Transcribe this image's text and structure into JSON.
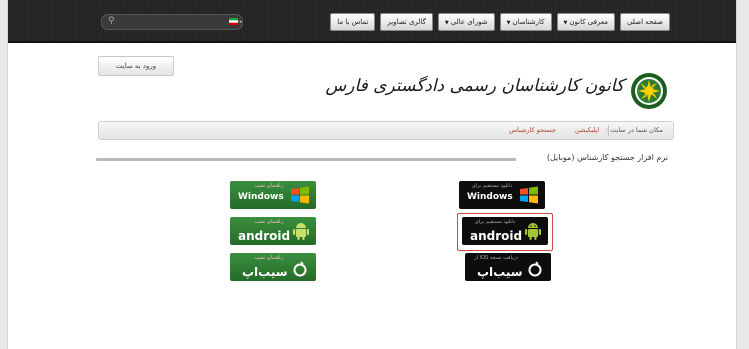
{
  "nav": {
    "items": [
      {
        "label": "صفحه اصلی",
        "dropdown": false
      },
      {
        "label": "معرفی کانون",
        "dropdown": true
      },
      {
        "label": "کارشناسان",
        "dropdown": true
      },
      {
        "label": "شورای عالی",
        "dropdown": true
      },
      {
        "label": "گالری تصاویر",
        "dropdown": false
      },
      {
        "label": "تماس با ما",
        "dropdown": false
      }
    ],
    "search_icon": "search-icon",
    "flag_icon": "flag-icon"
  },
  "login_label": "ورود به سایت",
  "logo": {
    "title": "کانون کارشناسان رسمی دادگستری فارس"
  },
  "breadcrumb": {
    "label": "مکان شما در سایت :",
    "items": [
      "اپلیکیشن",
      "جستجو کارشناس"
    ]
  },
  "section": {
    "title": "نرم افزار جستجو کارشناس (موبایل)"
  },
  "downloads": {
    "windows": {
      "sub": "دانلود مستقیم برای",
      "label": "Windows"
    },
    "android": {
      "sub": "دانلود مستقیم برای",
      "label": "android"
    },
    "ios": {
      "sub": "دریافت نسخه iOS از",
      "label": "سیب‌اپ"
    }
  },
  "guides": {
    "windows": {
      "sub": "راهنمای نصب",
      "label": "Windows"
    },
    "android": {
      "sub": "راهنمای نصب",
      "label": "android"
    },
    "ios": {
      "sub": "راهنمای نصب",
      "label": "سیب‌اپ"
    }
  },
  "colors": {
    "topbar": "#242424",
    "guide_green": "#2e7d32",
    "highlight": "#d34a4a",
    "link": "#b04030"
  }
}
